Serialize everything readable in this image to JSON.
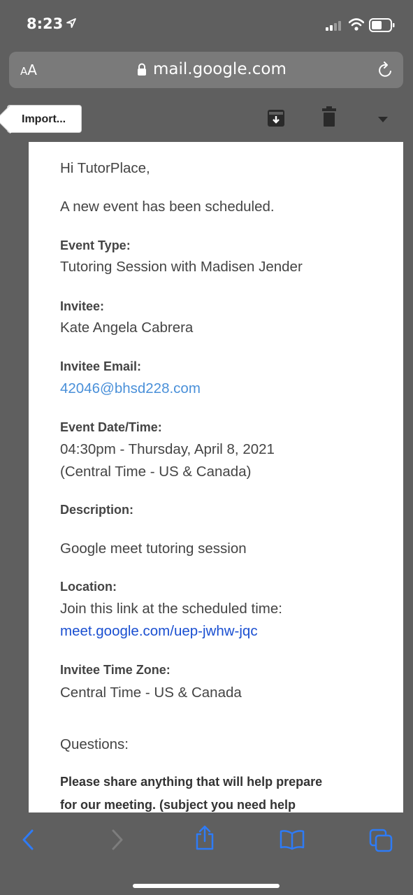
{
  "status_bar": {
    "time": "8:23"
  },
  "address_bar": {
    "aa_small": "A",
    "aa_large": "A",
    "url": "mail.google.com"
  },
  "toolbar": {
    "back_label": "Import..."
  },
  "email": {
    "greeting": "Hi TutorPlace,",
    "intro": "A new event has been scheduled.",
    "event_type_label": "Event Type:",
    "event_type_value": "Tutoring Session with Madisen Jender",
    "invitee_label": "Invitee:",
    "invitee_value": "Kate Angela Cabrera",
    "invitee_email_label": "Invitee Email:",
    "invitee_email_value": "42046@bhsd228.com",
    "event_datetime_label": "Event Date/Time:",
    "event_datetime_line1": "04:30pm - Thursday, April 8, 2021",
    "event_datetime_line2": "(Central Time - US & Canada)",
    "description_label": "Description:",
    "description_value": "Google meet tutoring session",
    "location_label": "Location:",
    "location_line1": "Join this link at the scheduled time:",
    "location_link": "meet.google.com/uep-jwhw-jqc",
    "timezone_label": "Invitee Time Zone:",
    "timezone_value": "Central Time - US & Canada",
    "questions_heading": "Questions:",
    "question_line1": "Please share anything that will help prepare",
    "question_line2": "for our meeting. (subject you need help"
  },
  "colors": {
    "chrome": "#5f5f5f",
    "accent_blue": "#2e7bf6",
    "email_link": "#4a90d9",
    "meet_link": "#1a4fd1"
  },
  "icons": [
    "location-arrow-icon",
    "signal-icon",
    "wifi-icon",
    "battery-icon",
    "lock-icon",
    "reload-icon",
    "archive-icon",
    "trash-icon",
    "chevron-down-icon",
    "back-arrow-icon",
    "forward-arrow-icon",
    "share-icon",
    "bookmarks-icon",
    "tabs-icon"
  ]
}
